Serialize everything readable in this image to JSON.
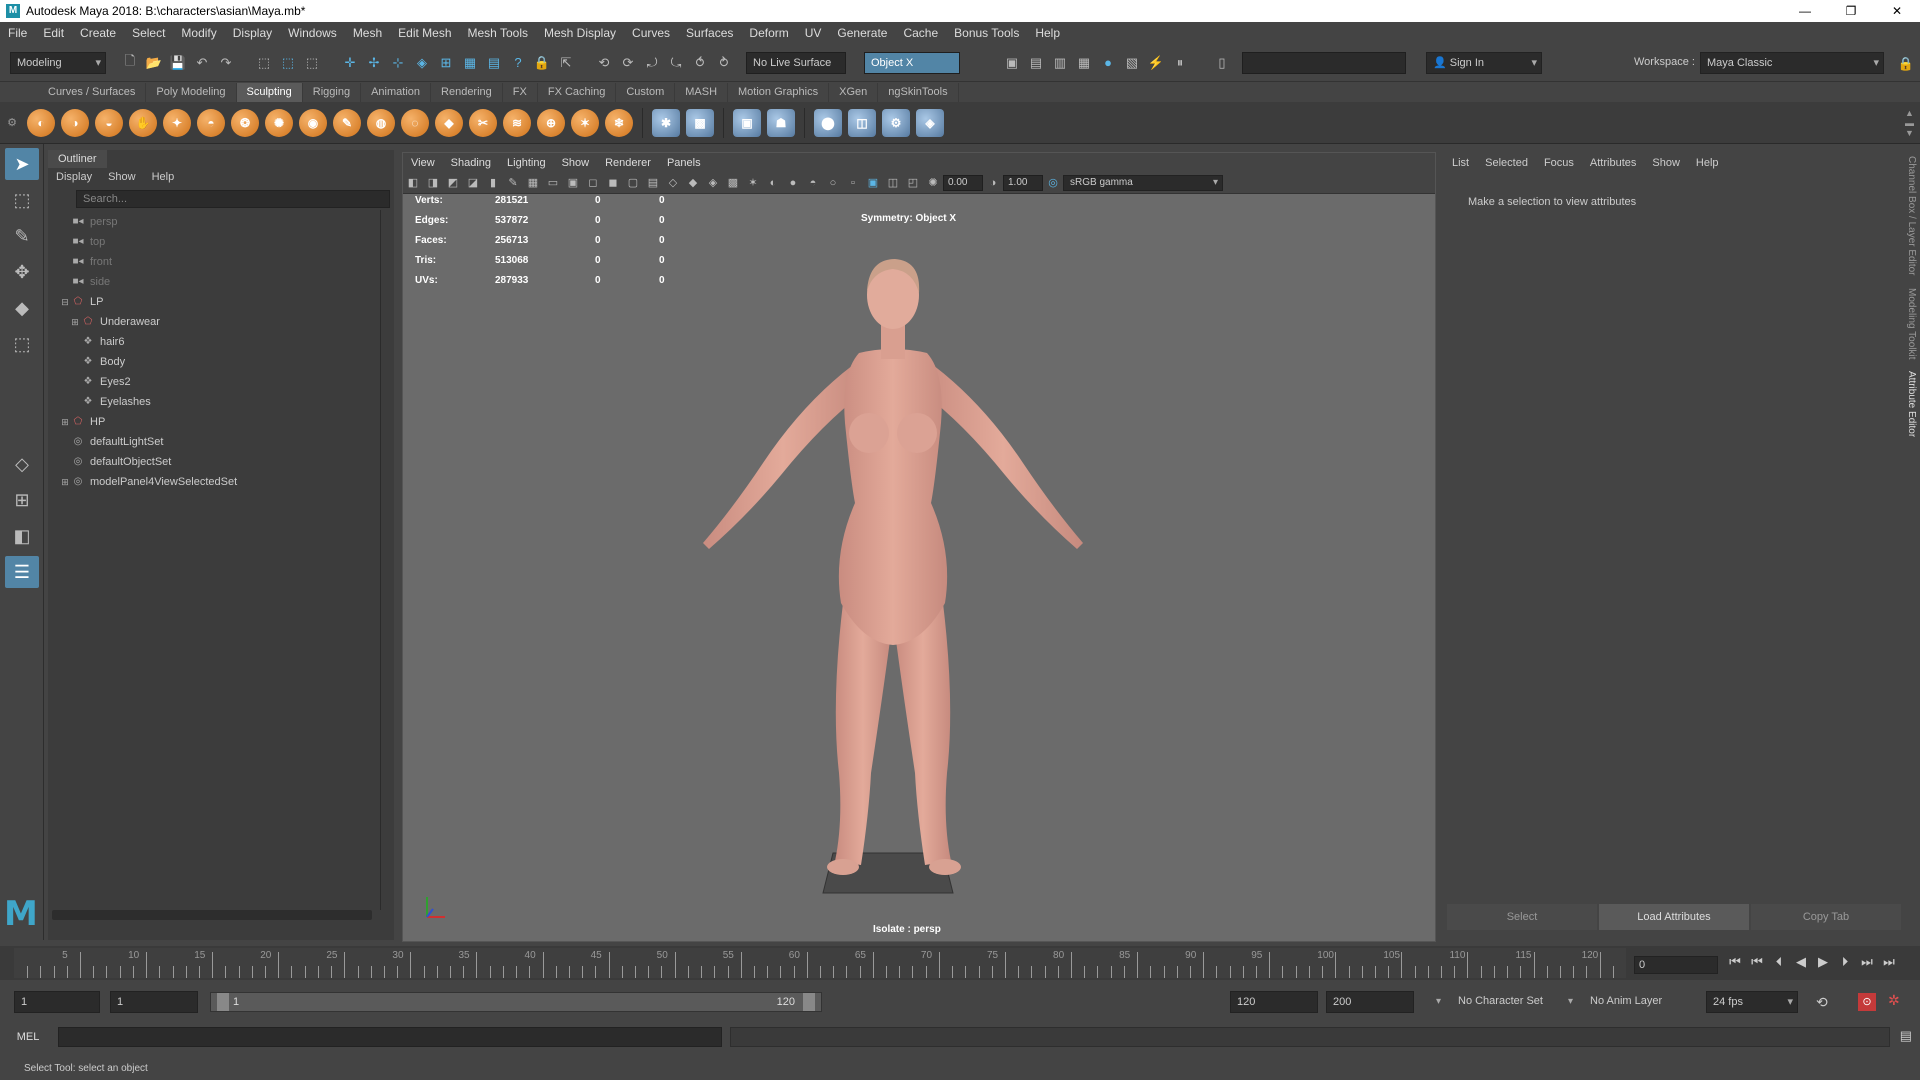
{
  "window": {
    "title": "Autodesk Maya 2018: B:\\characters\\asian\\Maya.mb*",
    "logo": "M",
    "minimize": "—",
    "maximize": "❐",
    "close": "✕"
  },
  "menubar": [
    "File",
    "Edit",
    "Create",
    "Select",
    "Modify",
    "Display",
    "Windows",
    "Mesh",
    "Edit Mesh",
    "Mesh Tools",
    "Mesh Display",
    "Curves",
    "Surfaces",
    "Deform",
    "UV",
    "Generate",
    "Cache",
    "Bonus Tools",
    "Help"
  ],
  "statusline": {
    "menuset": "Modeling",
    "live_surface": "No Live Surface",
    "symmetry": "Object X",
    "sign_in": "Sign In",
    "workspace_label": "Workspace :",
    "workspace_value": "Maya Classic"
  },
  "shelf_tabs": [
    "Curves / Surfaces",
    "Poly Modeling",
    "Sculpting",
    "Rigging",
    "Animation",
    "Rendering",
    "FX",
    "FX Caching",
    "Custom",
    "MASH",
    "Motion Graphics",
    "XGen",
    "ngSkinTools"
  ],
  "shelf_active": "Sculpting",
  "outliner": {
    "tab": "Outliner",
    "menus": [
      "Display",
      "Show",
      "Help"
    ],
    "search_placeholder": "Search...",
    "items": [
      {
        "label": "persp",
        "dim": true,
        "indent": 0,
        "icon": "camera-icon",
        "exp": ""
      },
      {
        "label": "top",
        "dim": true,
        "indent": 0,
        "icon": "camera-icon",
        "exp": ""
      },
      {
        "label": "front",
        "dim": true,
        "indent": 0,
        "icon": "camera-icon",
        "exp": ""
      },
      {
        "label": "side",
        "dim": true,
        "indent": 0,
        "icon": "camera-icon",
        "exp": ""
      },
      {
        "label": "LP",
        "dim": false,
        "indent": 0,
        "icon": "group-icon",
        "exp": "⊟"
      },
      {
        "label": "Underawear",
        "dim": false,
        "indent": 1,
        "icon": "group-icon",
        "exp": "⊞"
      },
      {
        "label": "hair6",
        "dim": false,
        "indent": 1,
        "icon": "mesh-icon",
        "exp": ""
      },
      {
        "label": "Body",
        "dim": false,
        "indent": 1,
        "icon": "mesh-icon",
        "exp": ""
      },
      {
        "label": "Eyes2",
        "dim": false,
        "indent": 1,
        "icon": "mesh-icon",
        "exp": ""
      },
      {
        "label": "Eyelashes",
        "dim": false,
        "indent": 1,
        "icon": "mesh-icon",
        "exp": ""
      },
      {
        "label": "HP",
        "dim": false,
        "indent": 0,
        "icon": "group-icon",
        "exp": "⊞"
      },
      {
        "label": "defaultLightSet",
        "dim": false,
        "indent": 0,
        "icon": "set-icon",
        "exp": ""
      },
      {
        "label": "defaultObjectSet",
        "dim": false,
        "indent": 0,
        "icon": "set-icon",
        "exp": ""
      },
      {
        "label": "modelPanel4ViewSelectedSet",
        "dim": false,
        "indent": 0,
        "icon": "set-icon",
        "exp": "⊞"
      }
    ]
  },
  "viewport": {
    "menus": [
      "View",
      "Shading",
      "Lighting",
      "Show",
      "Renderer",
      "Panels"
    ],
    "exposure": "0.00",
    "gamma": "1.00",
    "color_space": "sRGB gamma",
    "hud": [
      {
        "k": "Verts:",
        "v": "281521",
        "a": "0",
        "b": "0"
      },
      {
        "k": "Edges:",
        "v": "537872",
        "a": "0",
        "b": "0"
      },
      {
        "k": "Faces:",
        "v": "256713",
        "a": "0",
        "b": "0"
      },
      {
        "k": "Tris:",
        "v": "513068",
        "a": "0",
        "b": "0"
      },
      {
        "k": "UVs:",
        "v": "287933",
        "a": "0",
        "b": "0"
      }
    ],
    "symmetry_label": "Symmetry: Object X",
    "isolate_label": "Isolate : persp"
  },
  "attribute_editor": {
    "menus": [
      "List",
      "Selected",
      "Focus",
      "Attributes",
      "Show",
      "Help"
    ],
    "message": "Make a selection to view attributes",
    "buttons": [
      "Select",
      "Load Attributes",
      "Copy Tab"
    ]
  },
  "side_tabs": [
    "Channel Box / Layer Editor",
    "Modeling Toolkit",
    "Attribute Editor"
  ],
  "timeslider": {
    "ticks": [
      "5",
      "10",
      "15",
      "20",
      "25",
      "30",
      "35",
      "40",
      "45",
      "50",
      "55",
      "60",
      "65",
      "70",
      "75",
      "80",
      "85",
      "90",
      "95",
      "100",
      "105",
      "110",
      "115",
      "120"
    ],
    "current_frame": "0"
  },
  "range": {
    "start": "1",
    "playback_start": "1",
    "bar_left": "1",
    "bar_right": "120",
    "playback_end": "120",
    "end": "200",
    "character_set": "No Character Set",
    "anim_layer": "No Anim Layer",
    "fps": "24 fps"
  },
  "command": {
    "lang": "MEL"
  },
  "helpline": "Select Tool: select an object"
}
